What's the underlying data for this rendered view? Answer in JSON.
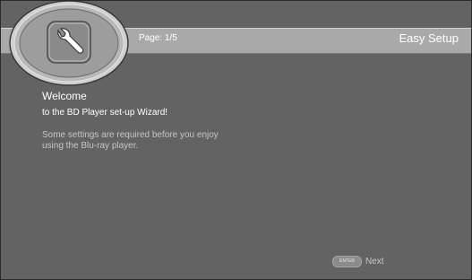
{
  "header": {
    "page_indicator": "Page: 1/5",
    "title": "Easy Setup",
    "emblem_icon": "wrench-icon"
  },
  "main": {
    "heading": "Welcome",
    "subheading": "to the BD Player set-up Wizard!",
    "info_lines": [
      "Some settings are required before you enjoy",
      "using the Blu-ray player."
    ]
  },
  "footer": {
    "key_label": "ENTER",
    "next_label": "Next"
  },
  "colors": {
    "background": "#636363",
    "band": "#a9a9a9",
    "text": "#ffffff",
    "muted_text": "#c6c6c6"
  }
}
